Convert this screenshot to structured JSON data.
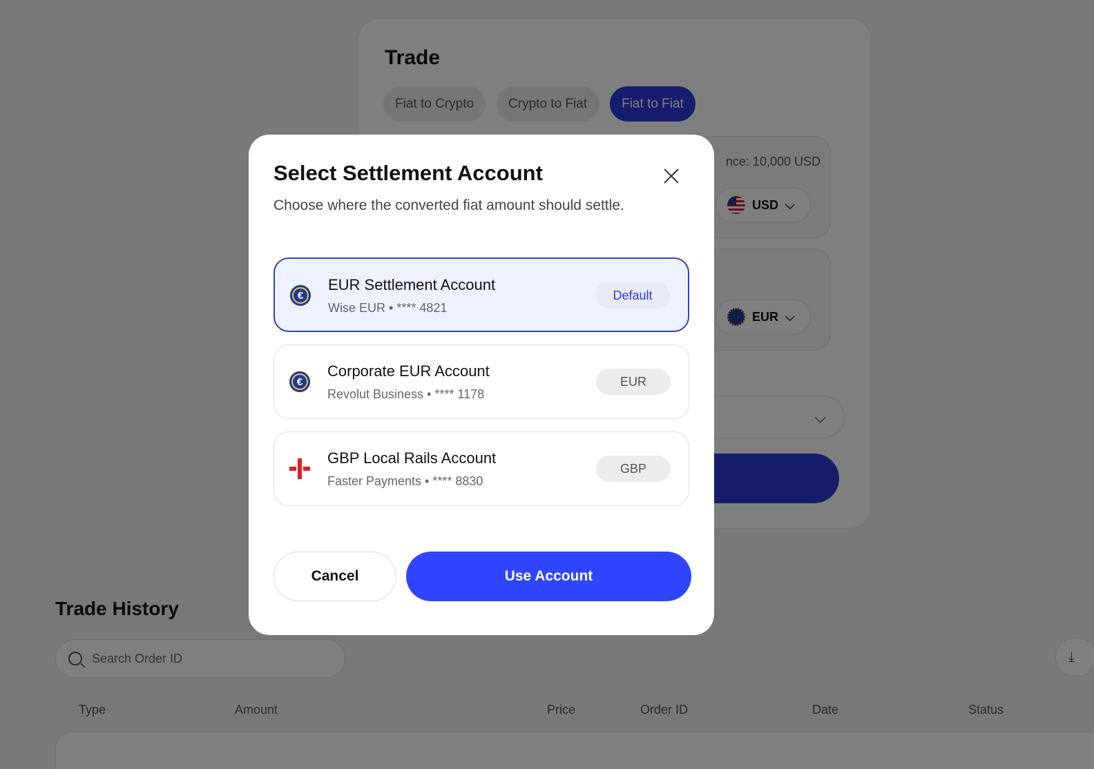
{
  "trade": {
    "title": "Trade",
    "tabs": [
      {
        "label": "Fiat to Crypto",
        "active": false
      },
      {
        "label": "Crypto to Fiat",
        "active": false
      },
      {
        "label": "Fiat to Fiat",
        "active": true
      }
    ],
    "balance_text": "nce: 10,000 USD",
    "from_currency": "USD",
    "to_currency": "EUR"
  },
  "history": {
    "title": "Trade History",
    "search_placeholder": "Search Order ID",
    "columns": [
      "Type",
      "Amount",
      "Price",
      "Order ID",
      "Date",
      "Status"
    ]
  },
  "modal": {
    "title": "Select Settlement Account",
    "subtitle": "Choose where the converted fiat amount should settle.",
    "accounts": [
      {
        "name": "EUR Settlement Account",
        "detail": "Wise EUR • **** 4821",
        "badge": "Default",
        "flag": "eu-flag-icon",
        "selected": true
      },
      {
        "name": "Corporate EUR Account",
        "detail": "Revolut Business • **** 1178",
        "badge": "EUR",
        "flag": "eu-flag-icon",
        "selected": false
      },
      {
        "name": "GBP Local Rails Account",
        "detail": "Faster Payments • **** 8830",
        "badge": "GBP",
        "flag": "gb-flag-icon",
        "selected": false
      }
    ],
    "cancel_label": "Cancel",
    "confirm_label": "Use Account"
  },
  "colors": {
    "accent": "#2f45ff",
    "selected_border": "#3340c4",
    "selected_bg": "#eef2ff"
  }
}
